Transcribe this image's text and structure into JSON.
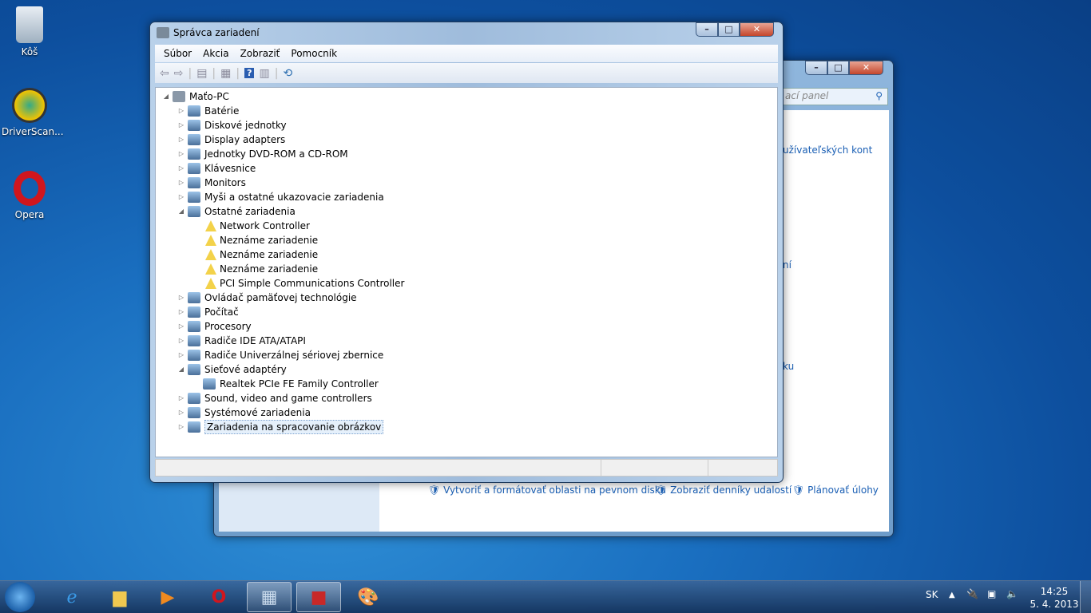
{
  "desktop": {
    "icons": [
      {
        "label": "Kôš"
      },
      {
        "label": "DriverScan..."
      },
      {
        "label": "Opera"
      }
    ]
  },
  "bg_window": {
    "search_placeholder": "ací panel",
    "links": [
      "užívateľských kont",
      "ní",
      "ku"
    ],
    "bottom_links": [
      "Vytvoriť a formátovať oblasti na pevnom disku",
      "Zobraziť denníky udalostí",
      "Plánovať úlohy"
    ]
  },
  "main_window": {
    "title": "Správca zariadení",
    "menu": [
      "Súbor",
      "Akcia",
      "Zobraziť",
      "Pomocník"
    ],
    "tree": [
      {
        "label": "Maťo-PC",
        "level": 0,
        "exp": "open"
      },
      {
        "label": "Batérie",
        "level": 1,
        "exp": "closed"
      },
      {
        "label": "Diskové jednotky",
        "level": 1,
        "exp": "closed"
      },
      {
        "label": "Display adapters",
        "level": 1,
        "exp": "closed"
      },
      {
        "label": "Jednotky DVD-ROM a CD-ROM",
        "level": 1,
        "exp": "closed"
      },
      {
        "label": "Klávesnice",
        "level": 1,
        "exp": "closed"
      },
      {
        "label": "Monitors",
        "level": 1,
        "exp": "closed"
      },
      {
        "label": "Myši a ostatné ukazovacie zariadenia",
        "level": 1,
        "exp": "closed"
      },
      {
        "label": "Ostatné zariadenia",
        "level": 1,
        "exp": "open"
      },
      {
        "label": "Network Controller",
        "level": 2,
        "warn": true
      },
      {
        "label": "Neznáme zariadenie",
        "level": 2,
        "warn": true
      },
      {
        "label": "Neznáme zariadenie",
        "level": 2,
        "warn": true
      },
      {
        "label": "Neznáme zariadenie",
        "level": 2,
        "warn": true
      },
      {
        "label": "PCI Simple Communications Controller",
        "level": 2,
        "warn": true
      },
      {
        "label": "Ovládač pamäťovej technológie",
        "level": 1,
        "exp": "closed"
      },
      {
        "label": "Počítač",
        "level": 1,
        "exp": "closed"
      },
      {
        "label": "Procesory",
        "level": 1,
        "exp": "closed"
      },
      {
        "label": "Radiče IDE ATA/ATAPI",
        "level": 1,
        "exp": "closed"
      },
      {
        "label": "Radiče Univerzálnej sériovej zbernice",
        "level": 1,
        "exp": "closed"
      },
      {
        "label": "Sieťové adaptéry",
        "level": 1,
        "exp": "open"
      },
      {
        "label": "Realtek PCIe FE Family Controller",
        "level": 2
      },
      {
        "label": "Sound, video and game controllers",
        "level": 1,
        "exp": "closed"
      },
      {
        "label": "Systémové zariadenia",
        "level": 1,
        "exp": "closed"
      },
      {
        "label": "Zariadenia na spracovanie obrázkov",
        "level": 1,
        "exp": "closed",
        "selected": true
      }
    ]
  },
  "tray": {
    "lang": "SK",
    "time": "14:25",
    "date": "5. 4. 2013"
  }
}
